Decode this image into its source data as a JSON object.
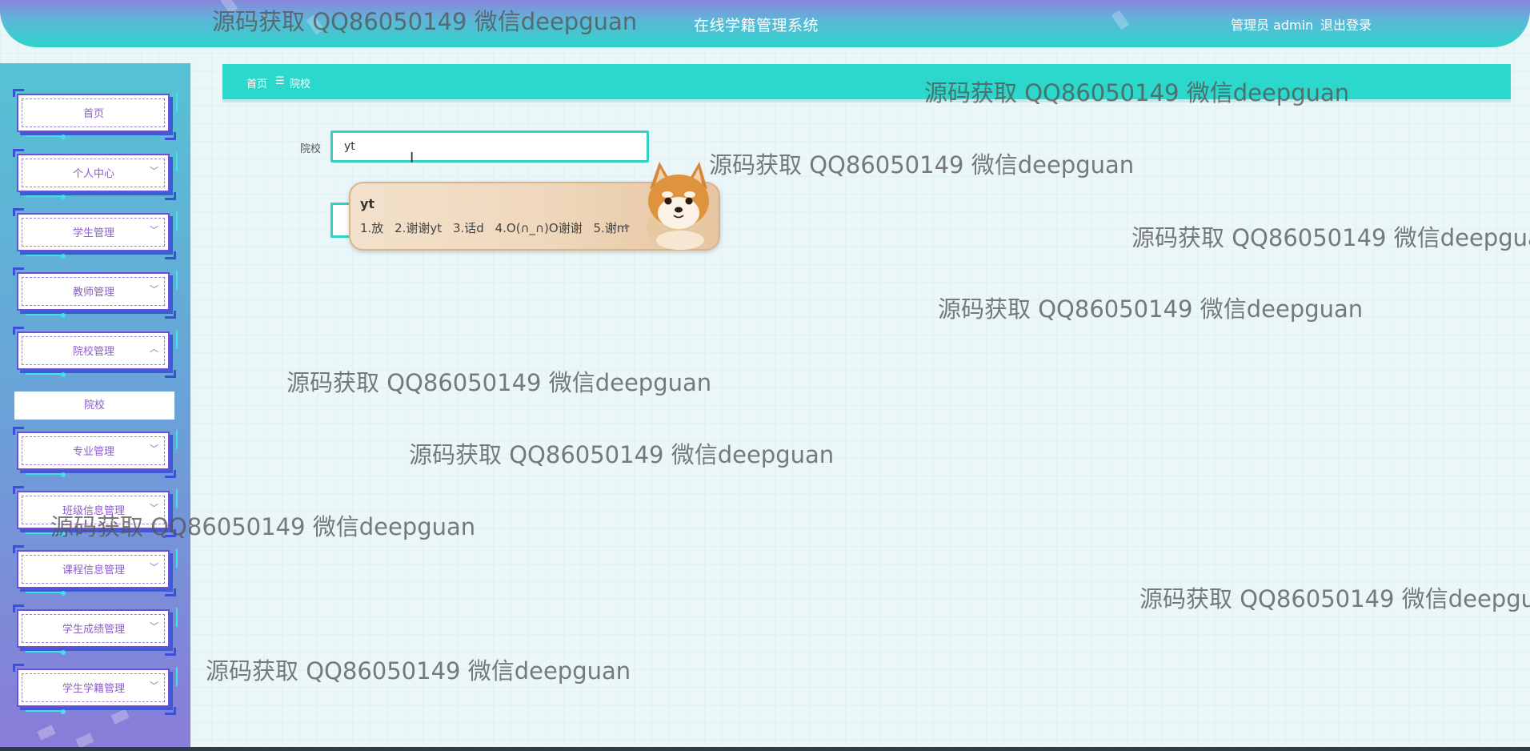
{
  "header": {
    "title": "在线学籍管理系统",
    "user": "管理员 admin",
    "logout": "退出登录"
  },
  "sidebar": {
    "items": [
      {
        "label": "首页",
        "chevron": ""
      },
      {
        "label": "个人中心",
        "chevron": "﹀"
      },
      {
        "label": "学生管理",
        "chevron": "﹀"
      },
      {
        "label": "教师管理",
        "chevron": "﹀"
      },
      {
        "label": "院校管理",
        "chevron": "︿"
      },
      {
        "label": "专业管理",
        "chevron": "﹀"
      },
      {
        "label": "班级信息管理",
        "chevron": "﹀"
      },
      {
        "label": "课程信息管理",
        "chevron": "﹀"
      },
      {
        "label": "学生成绩管理",
        "chevron": "﹀"
      },
      {
        "label": "学生学籍管理",
        "chevron": "﹀"
      }
    ],
    "submenu": {
      "label": "院校"
    }
  },
  "breadcrumb": {
    "home": "首页",
    "separator": "☰",
    "current": "院校"
  },
  "form": {
    "school_label": "院校",
    "school_value": "yt"
  },
  "ime": {
    "composition": "yt",
    "candidates": [
      "1.放",
      "2.谢谢yt",
      "3.话d",
      "4.O(∩_∩)O谢谢",
      "5.谢m"
    ],
    "next_arrow": "▸"
  },
  "watermark": {
    "text": "源码获取 QQ86050149 微信deepguan"
  },
  "colors": {
    "accent": "#2cd7cb",
    "menu_text": "#8b5fc7",
    "menu_border": "#6c4fd8"
  }
}
